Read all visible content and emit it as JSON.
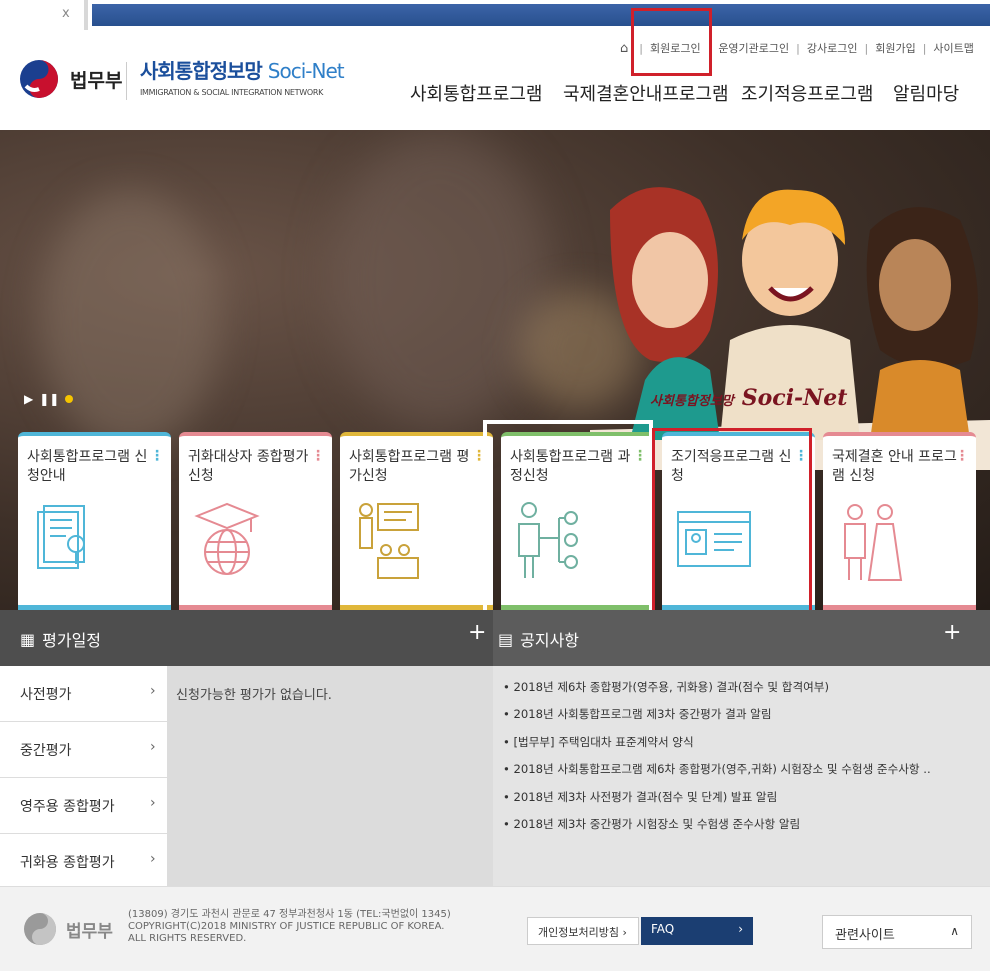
{
  "browser": {
    "tab_close": "x"
  },
  "logo": {
    "ministry": "법무부"
  },
  "brand": {
    "name_ko": "사회통합정보망",
    "name_en": "Soci-Net",
    "subtitle": "IMMIGRATION & SOCIAL INTEGRATION NETWORK"
  },
  "util_nav": [
    "회원로그인",
    "운영기관로그인",
    "강사로그인",
    "회원가입",
    "사이트맵"
  ],
  "gnb": [
    "사회통합프로그램",
    "국제결혼안내프로그램",
    "조기적응프로그램",
    "알림마당"
  ],
  "hero": {
    "slogan_ko": "사회통합정보망",
    "slogan_en": "Soci-Net"
  },
  "cards": [
    {
      "title": "사회통합프로그램 신청안내",
      "color": "#4fb6d8",
      "icon": "book-magnifier-icon"
    },
    {
      "title": "귀화대상자 종합평가 신청",
      "color": "#e58a92",
      "icon": "graduation-globe-icon"
    },
    {
      "title": "사회통합프로그램 평가신청",
      "color": "#e0b73a",
      "icon": "classroom-presentation-icon"
    },
    {
      "title": "사회통합프로그램 과정신청",
      "color": "#7fbf6a",
      "icon": "person-checklist-icon"
    },
    {
      "title": "조기적응프로그램 신청",
      "color": "#4fb6d8",
      "icon": "id-card-icon"
    },
    {
      "title": "국제결혼 안내 프로그램 신청",
      "color": "#e58a92",
      "icon": "wedding-couple-icon"
    }
  ],
  "schedule": {
    "title": "평가일정",
    "plus": "+",
    "items": [
      "사전평가",
      "중간평가",
      "영주용 종합평가",
      "귀화용 종합평가"
    ],
    "arrow": "›",
    "empty_message": "신청가능한 평가가 없습니다."
  },
  "notice": {
    "title": "공지사항",
    "plus": "+",
    "items": [
      "2018년 제6차 종합평가(영주용, 귀화용) 결과(점수 및 합격여부)",
      "2018년 사회통합프로그램 제3차 중간평가 결과 알림",
      "[법무부] 주택임대차 표준계약서 양식",
      "2018년 사회통합프로그램 제6차 종합평가(영주,귀화) 시험장소 및 수험생 준수사항 ..",
      "2018년 제3차 사전평가 결과(점수 및 단계) 발표 알림",
      "2018년 제3차 중간평가 시험장소 및 수험생 준수사항 알림"
    ]
  },
  "footer": {
    "ministry": "법무부",
    "address": "(13809) 경기도 과천시 관문로 47 정부과천청사 1동 (TEL:국번없이 1345)",
    "copyright": "COPYRIGHT(C)2018 MINISTRY OF JUSTICE REPUBLIC OF KOREA.",
    "rights": "ALL RIGHTS RESERVED.",
    "privacy": "개인정보처리방침 ›",
    "faq": "FAQ",
    "faq_arrow": "›",
    "related": "관련사이트",
    "related_arrow": "∧"
  }
}
